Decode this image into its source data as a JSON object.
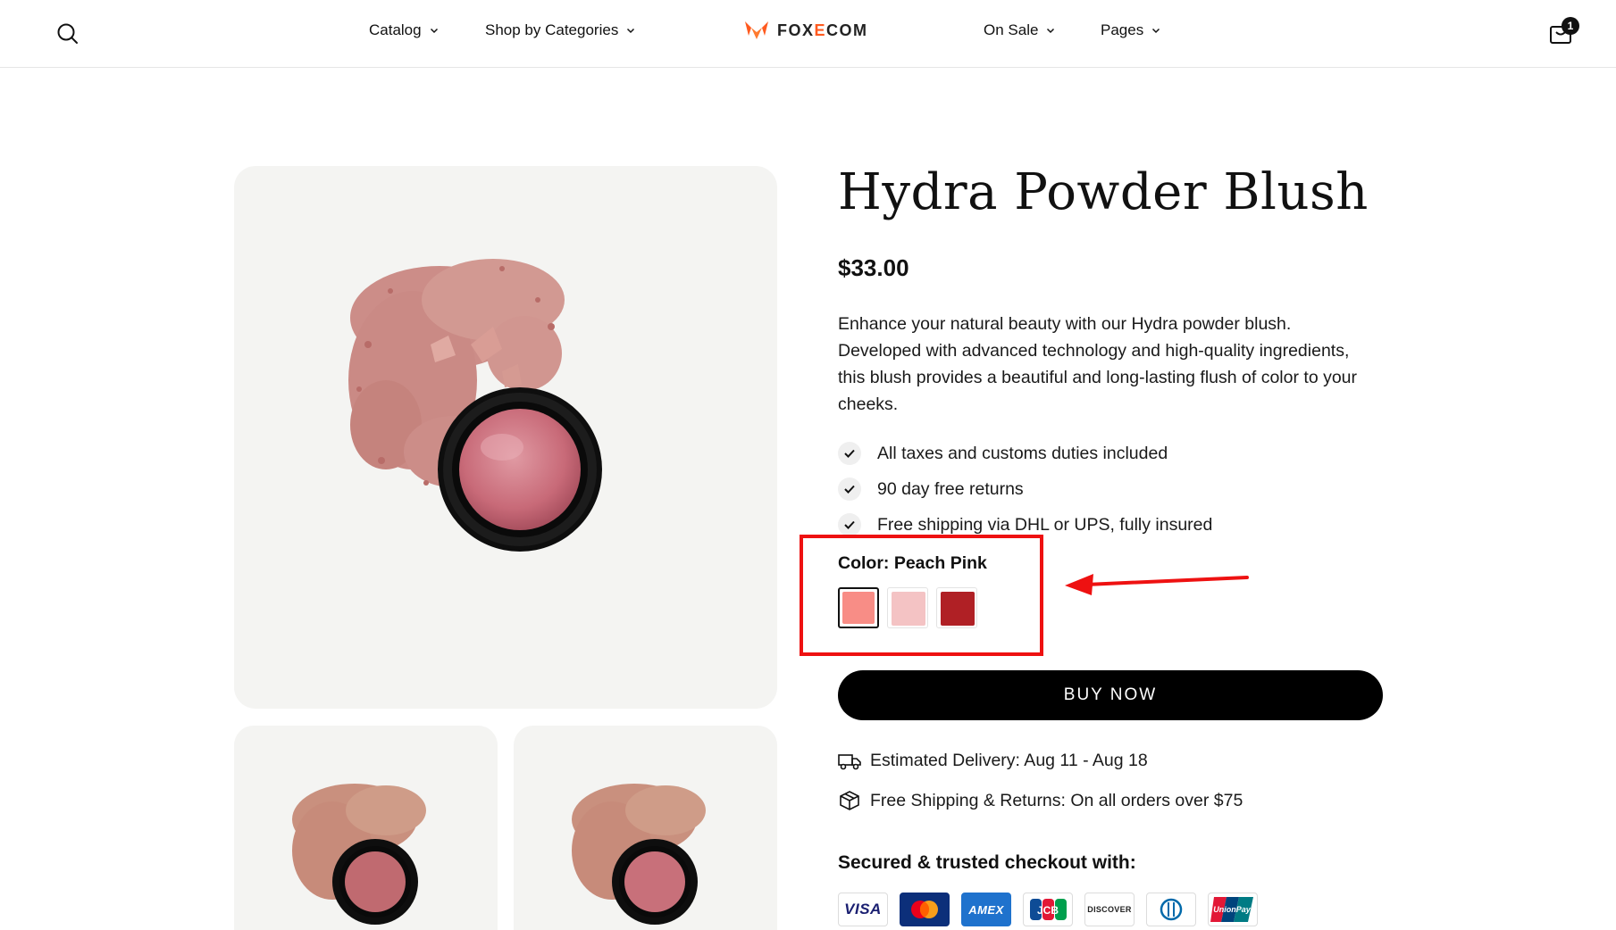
{
  "header": {
    "nav_left": [
      {
        "label": "Catalog"
      },
      {
        "label": "Shop by Categories"
      }
    ],
    "logo": {
      "prefix": "FOX",
      "accent": "E",
      "suffix": "COM"
    },
    "nav_right": [
      {
        "label": "On Sale"
      },
      {
        "label": "Pages"
      }
    ],
    "cart_count": "1"
  },
  "product": {
    "title": "Hydra Powder Blush",
    "price": "$33.00",
    "description": "Enhance your natural beauty with our Hydra powder blush. Developed with advanced technology and high-quality ingredients, this blush provides a beautiful and long-lasting flush of color to your cheeks.",
    "features": [
      "All taxes and customs duties included",
      "90 day free returns",
      "Free shipping via DHL or UPS, fully insured"
    ],
    "color_label": "Color: Peach Pink",
    "swatches": [
      {
        "name": "Peach Pink",
        "color": "#f88d86",
        "selected": true
      },
      {
        "name": "Light Pink",
        "color": "#f4c3c4",
        "selected": false
      },
      {
        "name": "Deep Red",
        "color": "#b02025",
        "selected": false
      }
    ],
    "buy_label": "BUY NOW",
    "delivery": "Estimated Delivery: Aug 11 - Aug 18",
    "shipping": "Free Shipping & Returns: On all orders over $75",
    "secured_label": "Secured & trusted checkout with:",
    "payments": {
      "visa": "VISA",
      "mastercard": "",
      "amex": "AMEX",
      "jcb": "JCB",
      "discover": "DISCOVER",
      "diners": "",
      "unionpay": "UnionPay"
    }
  },
  "colors": {
    "brand_accent": "#ff5a1f",
    "highlight": "#ee1111",
    "button": "#000000"
  }
}
